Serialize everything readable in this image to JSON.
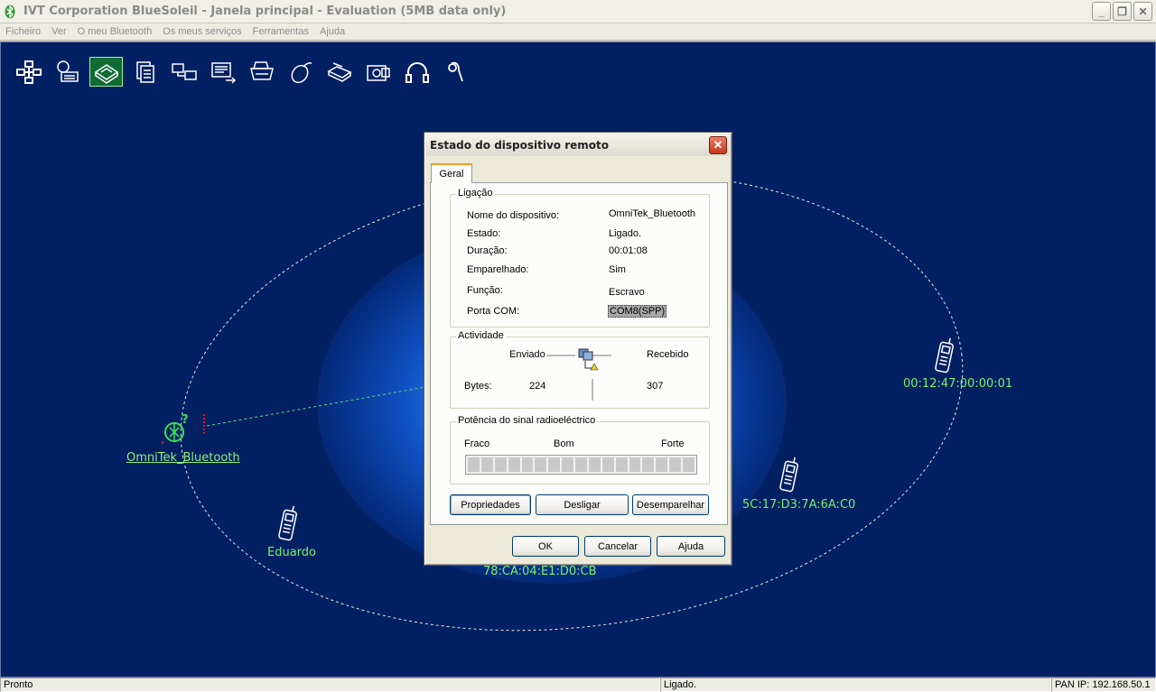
{
  "window": {
    "title": "IVT Corporation BlueSoleil - Janela principal - Evaluation (5MB data only)",
    "controls": {
      "minimize": "_",
      "restore": "❐",
      "close": "✕"
    }
  },
  "menu": [
    "Ficheiro",
    "Ver",
    "O meu Bluetooth",
    "Os meus serviços",
    "Ferramentas",
    "Ajuda"
  ],
  "toolbar_icons": [
    "network-hub-icon",
    "dialup-icon",
    "lan-access-icon",
    "file-transfer-icon",
    "sync-icon",
    "object-push-icon",
    "printer-icon",
    "mouse-icon",
    "fax-icon",
    "camera-icon",
    "headphones-icon",
    "headset-icon"
  ],
  "devices": {
    "local": "OmniTek_Bluetooth",
    "eduardo": "Eduardo",
    "dev1": "00:12:47:00:00:01",
    "dev2": "5C:17:D3:7A:6A:C0",
    "dev3": "78:CA:04:E1:D0:CB"
  },
  "dialog": {
    "title": "Estado do dispositivo remoto",
    "tab": "Geral",
    "connection": {
      "title": "Ligação",
      "rows": [
        {
          "label": "Nome do dispositivo:",
          "value": "OmniTek_Bluetooth"
        },
        {
          "label": "Estado:",
          "value": "Ligado."
        },
        {
          "label": "Duração:",
          "value": "00:01:08"
        },
        {
          "label": "Emparelhado:",
          "value": "Sim"
        },
        {
          "label": "Função:",
          "value": "Escravo"
        },
        {
          "label": "Porta COM:",
          "value": "COM8(SPP)"
        }
      ]
    },
    "activity": {
      "title": "Actividade",
      "sent_label": "Enviado",
      "received_label": "Recebido",
      "bytes_label": "Bytes:",
      "sent": "224",
      "received": "307"
    },
    "signal": {
      "title": "Potência do sinal radioeléctrico",
      "weak": "Fraco",
      "good": "Bom",
      "strong": "Forte",
      "segments": 17,
      "level": 0
    },
    "buttons": {
      "properties": "Propriedades",
      "disconnect": "Desligar",
      "unpair": "Desemparelhar",
      "ok": "OK",
      "cancel": "Cancelar",
      "help": "Ajuda"
    }
  },
  "status": {
    "left": "Pronto",
    "middle": "Ligado.",
    "right": "PAN IP: 192.168.50.1"
  }
}
